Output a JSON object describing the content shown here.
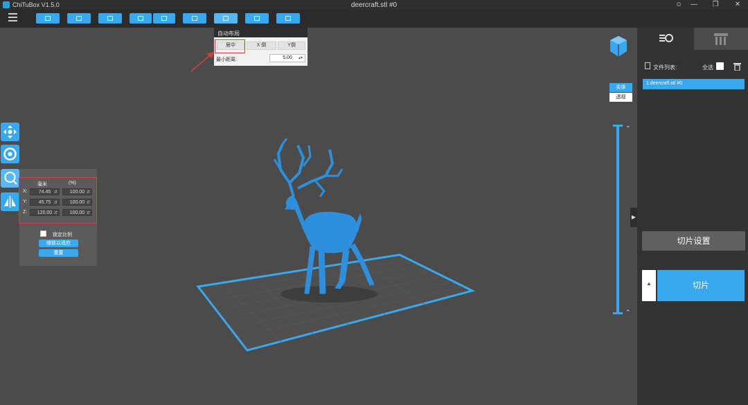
{
  "app": {
    "name": "ChiTuBox V1.5.0",
    "window_title": "deercraft.stl #0"
  },
  "colors": {
    "accent": "#3aa8ee",
    "highlight": "#d93d3d",
    "viewport": "#4b4b4b",
    "panel": "#333333"
  },
  "toolbar": {
    "buttons": [
      "open-icon",
      "save-icon",
      "import-icon",
      "undo-icon",
      "redo-icon",
      "copy-icon",
      "arrange-icon",
      "support-icon",
      "settings-icon"
    ]
  },
  "auto_layout": {
    "title": "自动布局",
    "center": "居中",
    "x_axis": "X 倒",
    "y_axis": "Y倒",
    "min_spacing_label": "最小距离:",
    "min_spacing_value": "5.00"
  },
  "scale": {
    "unit_mm": "毫米",
    "unit_pct": "(%)",
    "axes": [
      {
        "label": "X:",
        "mm": "74.45",
        "pct": "100.00"
      },
      {
        "label": "Y:",
        "mm": "45.75",
        "pct": "100.00"
      },
      {
        "label": "Z:",
        "mm": "120.00",
        "pct": "100.00"
      }
    ],
    "lock_label": "锁定比例",
    "fit_button": "缩放以适应",
    "reset_button": "重置"
  },
  "view": {
    "solid": "实体",
    "xray": "透视"
  },
  "files": {
    "list_label": "文件列表:",
    "select_all": "全选",
    "items": [
      "1.deercraft.stl #0"
    ]
  },
  "actions": {
    "slice_settings": "切片设置",
    "slice": "切片"
  }
}
